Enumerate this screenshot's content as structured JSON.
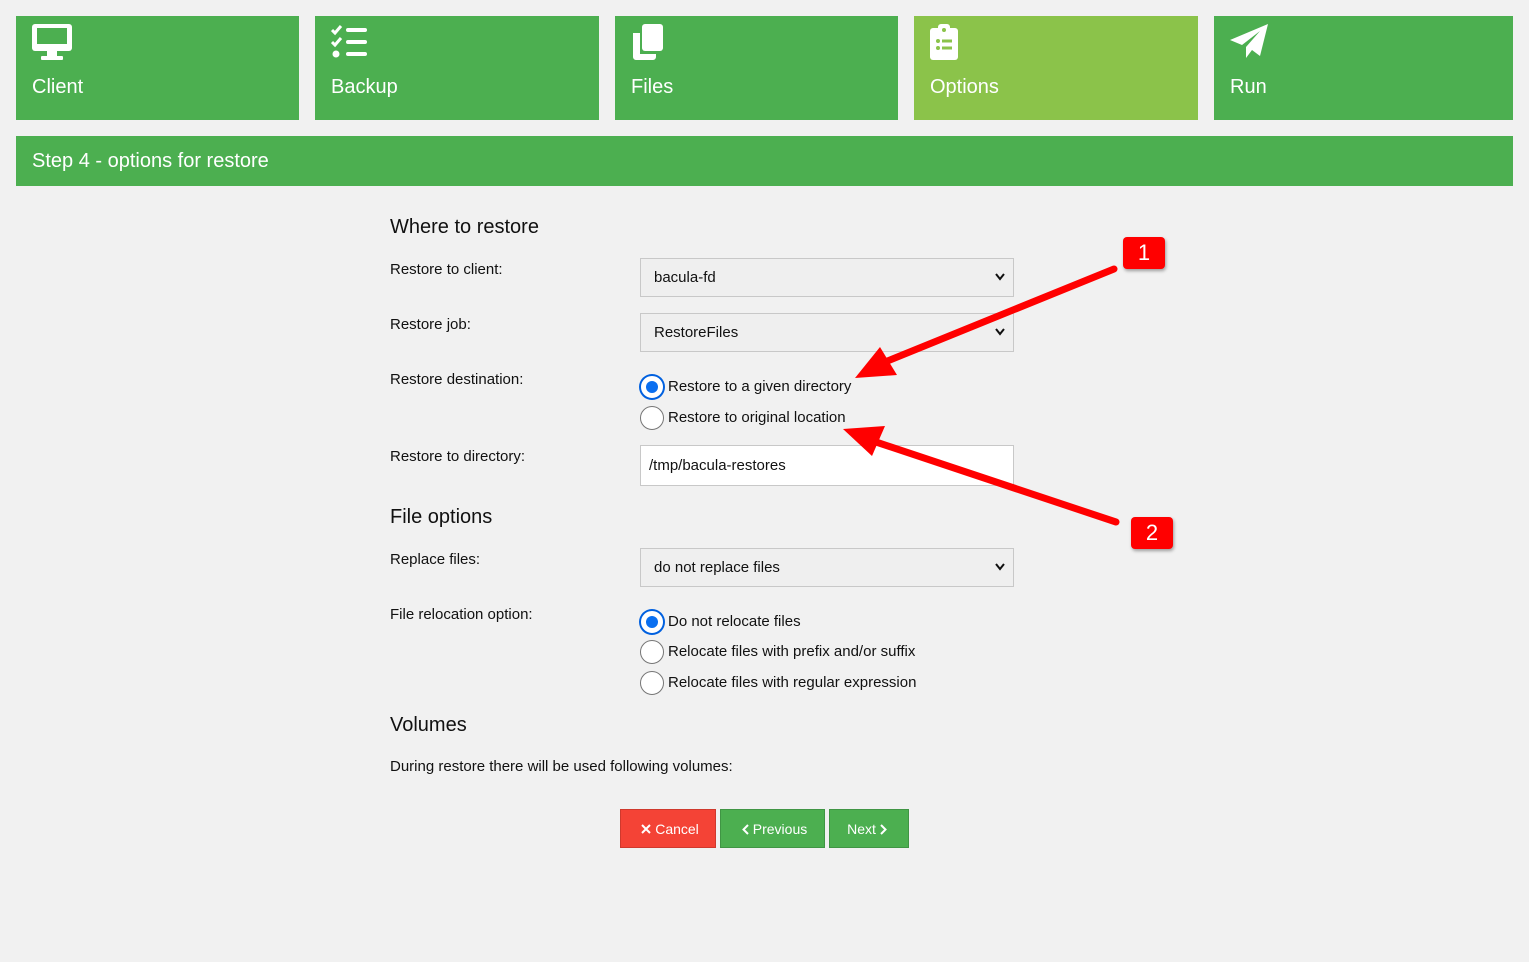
{
  "wizard_steps": [
    {
      "label": "Client",
      "icon": "desktop-icon"
    },
    {
      "label": "Backup",
      "icon": "tasks-list-icon"
    },
    {
      "label": "Files",
      "icon": "copy-files-icon"
    },
    {
      "label": "Options",
      "icon": "clipboard-list-icon",
      "active": true
    },
    {
      "label": "Run",
      "icon": "paper-plane-icon"
    }
  ],
  "colors": {
    "step": "#4caf50",
    "step_active": "#8bc34a",
    "cancel": "#f44336",
    "annotation": "#ff0000"
  },
  "step_title": "Step 4 - options for restore",
  "where": {
    "heading": "Where to restore",
    "client_label": "Restore to client:",
    "client_value": "bacula-fd",
    "job_label": "Restore job:",
    "job_value": "RestoreFiles",
    "destination_label": "Restore destination:",
    "destination_options": [
      "Restore to a given directory",
      "Restore to original location"
    ],
    "destination_selected": 0,
    "directory_label": "Restore to directory:",
    "directory_value": "/tmp/bacula-restores"
  },
  "file_options": {
    "heading": "File options",
    "replace_label": "Replace files:",
    "replace_value": "do not replace files",
    "relocation_label": "File relocation option:",
    "relocation_options": [
      "Do not relocate files",
      "Relocate files with prefix and/or suffix",
      "Relocate files with regular expression"
    ],
    "relocation_selected": 0
  },
  "volumes": {
    "heading": "Volumes",
    "text": "During restore there will be used following volumes:"
  },
  "buttons": {
    "cancel": "Cancel",
    "previous": "Previous",
    "next": "Next"
  },
  "annotations": [
    "1",
    "2"
  ]
}
